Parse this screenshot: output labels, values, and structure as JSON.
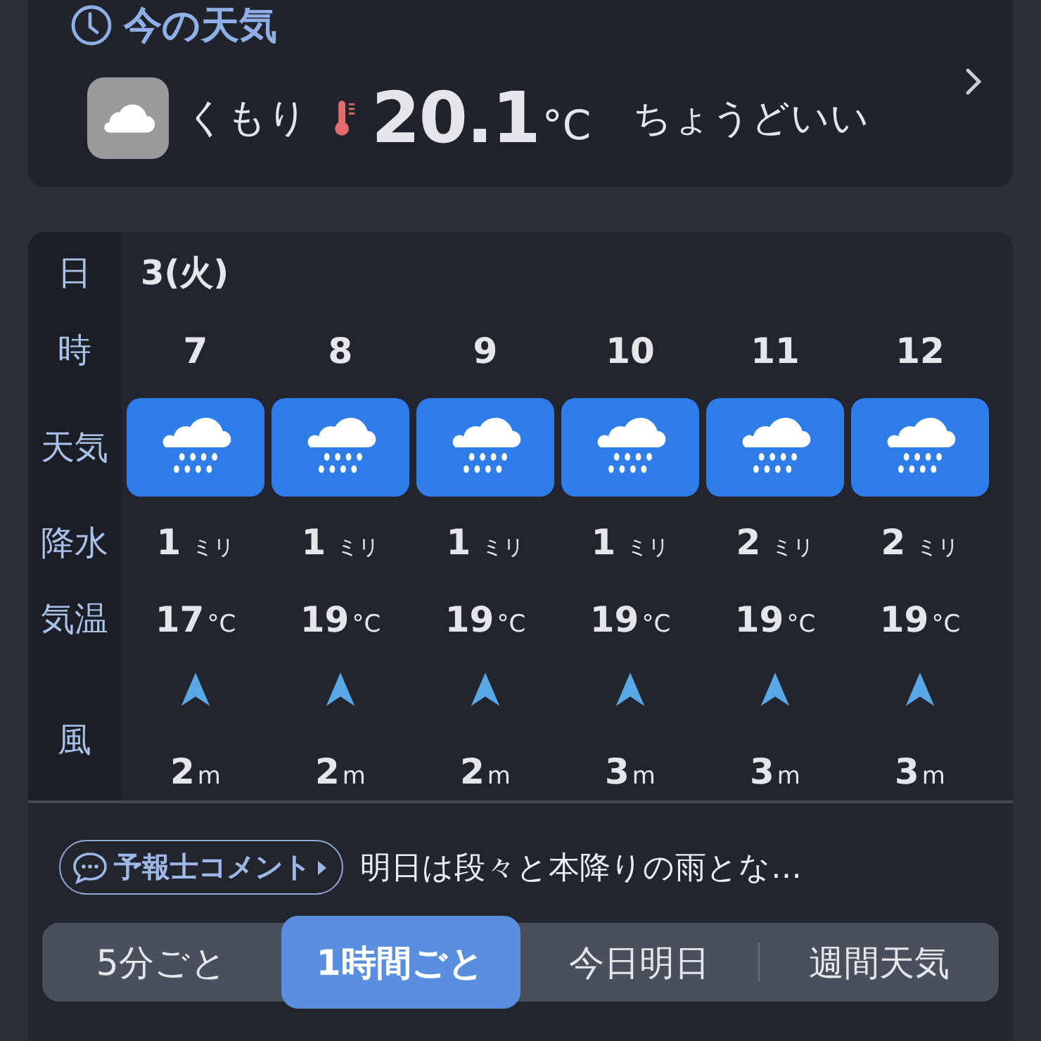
{
  "now": {
    "title": "今の天気",
    "kind": "cloudy",
    "condition": "くもり",
    "temperature": "20.1",
    "temp_unit": "°C",
    "feel": "ちょうどいい"
  },
  "hourly": {
    "labels": {
      "date": "日",
      "hour": "時",
      "weather": "天気",
      "precip": "降水",
      "temp": "気温",
      "wind": "風"
    },
    "date": "3(火)",
    "hours": [
      {
        "hour": "7",
        "kind": "rain",
        "precip": "1",
        "precip_unit": "ミリ",
        "temp": "17",
        "temp_unit": "°C",
        "wind": "2",
        "wind_unit": "m"
      },
      {
        "hour": "8",
        "kind": "rain",
        "precip": "1",
        "precip_unit": "ミリ",
        "temp": "19",
        "temp_unit": "°C",
        "wind": "2",
        "wind_unit": "m"
      },
      {
        "hour": "9",
        "kind": "rain",
        "precip": "1",
        "precip_unit": "ミリ",
        "temp": "19",
        "temp_unit": "°C",
        "wind": "2",
        "wind_unit": "m"
      },
      {
        "hour": "10",
        "kind": "rain",
        "precip": "1",
        "precip_unit": "ミリ",
        "temp": "19",
        "temp_unit": "°C",
        "wind": "3",
        "wind_unit": "m"
      },
      {
        "hour": "11",
        "kind": "rain",
        "precip": "2",
        "precip_unit": "ミリ",
        "temp": "19",
        "temp_unit": "°C",
        "wind": "3",
        "wind_unit": "m"
      },
      {
        "hour": "12",
        "kind": "rain",
        "precip": "2",
        "precip_unit": "ミリ",
        "temp": "19",
        "temp_unit": "°C",
        "wind": "3",
        "wind_unit": "m"
      }
    ]
  },
  "comment": {
    "button": "予報士コメント",
    "text": "明日は段々と本降りの雨とな…"
  },
  "tabs": [
    {
      "label": "5分ごと",
      "selected": false
    },
    {
      "label": "1時間ごと",
      "selected": true
    },
    {
      "label": "今日明日",
      "selected": false
    },
    {
      "label": "週間天気",
      "selected": false
    }
  ]
}
